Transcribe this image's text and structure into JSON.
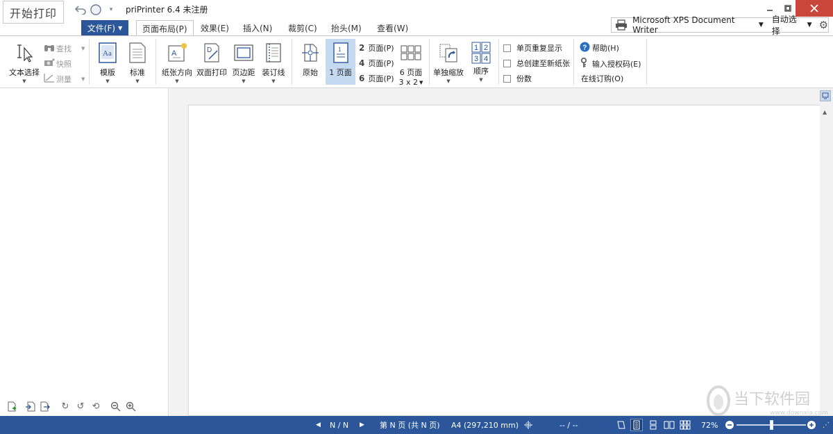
{
  "app": {
    "start_print": "开始打印",
    "title": "priPrinter 6.4 未注册"
  },
  "tabs": {
    "file": "文件(F)",
    "items": [
      "页面布局(P)",
      "效果(E)",
      "插入(N)",
      "裁剪(C)",
      "抬头(M)",
      "查看(W)"
    ]
  },
  "printer": {
    "name": "Microsoft XPS Document Writer",
    "mode": "自动选择"
  },
  "ribbon": {
    "text_select": "文本选择",
    "find": "查找",
    "snapshot": "快照",
    "measure": "测量",
    "template": "模版",
    "standard": "标准",
    "orientation": "纸张方向",
    "duplex": "双面打印",
    "margins": "页边距",
    "binding": "装订线",
    "original": "原始",
    "one_page": "1 页面",
    "two_pages_num": "2",
    "two_pages": "页面(P)",
    "four_pages_num": "4",
    "four_pages": "页面(P)",
    "six_pages_num": "6",
    "six_pages": "页面(P)",
    "six_grid": "6 页面",
    "six_grid_sub": "3 x 2",
    "single_zoom": "单独缩放",
    "order": "顺序",
    "order_digits": [
      "1",
      "2",
      "3",
      "4"
    ],
    "single_repeat": "单页重复显示",
    "always_new_sheet": "总创建至新纸张",
    "copies": "份数",
    "help": "帮助(H)",
    "enter_license": "输入授权码(E)",
    "buy_online": "在线订购(O)"
  },
  "status": {
    "page_nav": "N / N",
    "page_info": "第 N 页 (共 N 页)",
    "paper": "A4 (297,210 mm)",
    "coords": "-- / --",
    "zoom": "72%",
    "zoom_level": 0.5
  },
  "watermark": {
    "text": "当下软件园",
    "url": "www.downxia.com"
  },
  "colors": {
    "accent": "#2b579a",
    "close": "#c9463a"
  }
}
